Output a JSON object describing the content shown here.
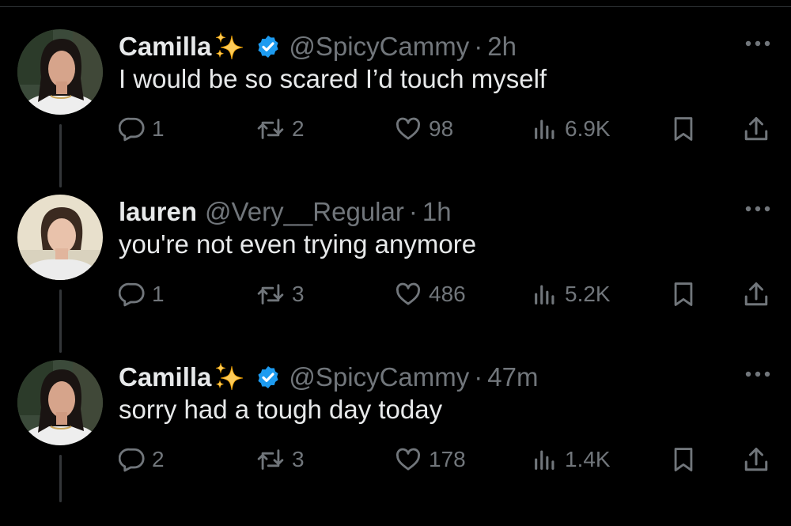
{
  "colors": {
    "background": "#000000",
    "text": "#e7e9ea",
    "muted": "#71767b",
    "verified": "#1d9bf0",
    "sparkle": "#fdcb58"
  },
  "tweets": [
    {
      "name": "Camilla",
      "name_emoji": "sparkles-emoji",
      "verified": true,
      "handle": "@SpicyCammy",
      "separator": "·",
      "time": "2h",
      "text": "I would be so scared I’d touch myself",
      "replies": "1",
      "retweets": "2",
      "likes": "98",
      "views": "6.9K"
    },
    {
      "name": "lauren",
      "verified": false,
      "handle": "@Very__Regular",
      "separator": "·",
      "time": "1h",
      "text": "you're not even trying anymore",
      "replies": "1",
      "retweets": "3",
      "likes": "486",
      "views": "5.2K"
    },
    {
      "name": "Camilla",
      "name_emoji": "sparkles-emoji",
      "verified": true,
      "handle": "@SpicyCammy",
      "separator": "·",
      "time": "47m",
      "text": "sorry had a tough day today",
      "replies": "2",
      "retweets": "3",
      "likes": "178",
      "views": "1.4K"
    }
  ]
}
